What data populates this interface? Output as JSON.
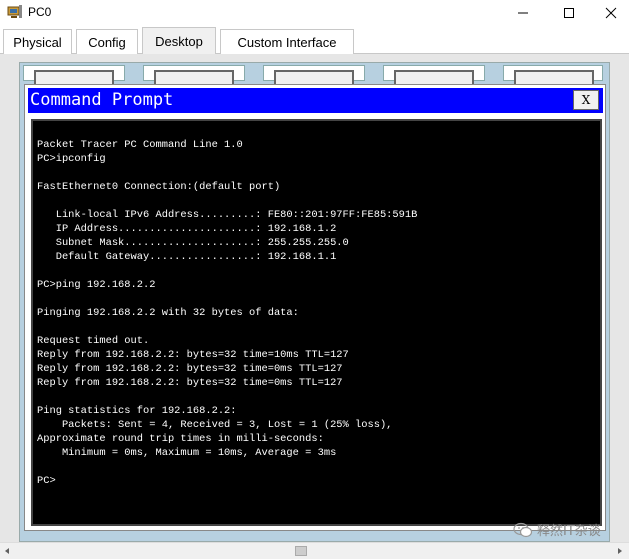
{
  "window": {
    "title": "PC0",
    "minimize_glyph": "—",
    "maximize_glyph": "☐",
    "close_glyph": "✕"
  },
  "tabs": [
    {
      "label": "Physical",
      "active": false
    },
    {
      "label": "Config",
      "active": false
    },
    {
      "label": "Desktop",
      "active": true
    },
    {
      "label": "Custom Interface",
      "active": false
    }
  ],
  "cmd": {
    "title": "Command Prompt",
    "close_label": "X"
  },
  "terminal": {
    "lines": [
      "Packet Tracer PC Command Line 1.0",
      "PC>ipconfig",
      "",
      "FastEthernet0 Connection:(default port)",
      "",
      "   Link-local IPv6 Address.........: FE80::201:97FF:FE85:591B",
      "   IP Address......................: 192.168.1.2",
      "   Subnet Mask.....................: 255.255.255.0",
      "   Default Gateway.................: 192.168.1.1",
      "",
      "PC>ping 192.168.2.2",
      "",
      "Pinging 192.168.2.2 with 32 bytes of data:",
      "",
      "Request timed out.",
      "Reply from 192.168.2.2: bytes=32 time=10ms TTL=127",
      "Reply from 192.168.2.2: bytes=32 time=0ms TTL=127",
      "Reply from 192.168.2.2: bytes=32 time=0ms TTL=127",
      "",
      "Ping statistics for 192.168.2.2:",
      "    Packets: Sent = 4, Received = 3, Lost = 1 (25% loss),",
      "Approximate round trip times in milli-seconds:",
      "    Minimum = 0ms, Maximum = 10ms, Average = 3ms",
      "",
      "PC>"
    ]
  },
  "watermark": {
    "text": "释然IT杂谈"
  },
  "colors": {
    "cmd_title_bg": "#0000ff",
    "terminal_bg": "#000000",
    "terminal_fg": "#ffffff",
    "desktop_bg": "#b7d0e0"
  },
  "icons": {
    "app": "packet-tracer-pc-icon",
    "watermark": "wechat-icon"
  }
}
